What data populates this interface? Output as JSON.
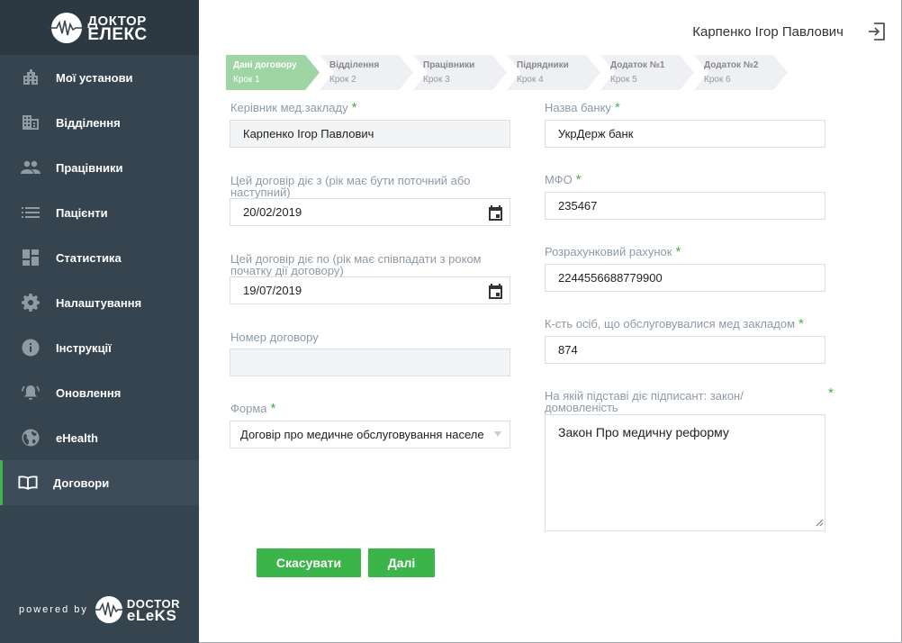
{
  "brand": {
    "logo_line1": "ДОКТОР",
    "logo_line2": "ЕЛЕКС",
    "powered_by": "powered by",
    "footer_line1": "DOCTOR",
    "footer_line2": "eLeKS"
  },
  "sidebar": {
    "items": [
      {
        "label": "Мої установи",
        "icon": "building-icon"
      },
      {
        "label": "Відділення",
        "icon": "office-icon"
      },
      {
        "label": "Працівники",
        "icon": "people-icon"
      },
      {
        "label": "Пацієнти",
        "icon": "list-icon"
      },
      {
        "label": "Статистика",
        "icon": "dashboard-icon"
      },
      {
        "label": "Налаштування",
        "icon": "gear-icon"
      },
      {
        "label": "Інструкції",
        "icon": "info-icon"
      },
      {
        "label": "Оновлення",
        "icon": "bell-icon"
      },
      {
        "label": "eHealth",
        "icon": "globe-icon"
      },
      {
        "label": "Договори",
        "icon": "book-icon",
        "active": true
      }
    ]
  },
  "header": {
    "user_name": "Карпенко Ігор Павлович"
  },
  "steps": [
    {
      "title": "Дані договору",
      "sub": "Крок 1",
      "active": true
    },
    {
      "title": "Відділення",
      "sub": "Крок 2"
    },
    {
      "title": "Працівники",
      "sub": "Крок 3"
    },
    {
      "title": "Підрядники",
      "sub": "Крок 4"
    },
    {
      "title": "Додаток №1",
      "sub": "Крок 5"
    },
    {
      "title": "Додаток №2",
      "sub": "Крок 6"
    }
  ],
  "form": {
    "head_label": "Керівник мед.закладу",
    "head_value": "Карпенко Ігор Павлович",
    "from_label": "Цей договір діє з (рік має бути поточний або наступний)",
    "from_value": "20/02/2019",
    "to_label": "Цей договір діє по (рік має співпадати з роком початку дії договору)",
    "to_value": "19/07/2019",
    "number_label": "Номер договору",
    "number_value": "",
    "form_label": "Форма",
    "form_value": "Договір про медичне обслуговування населе",
    "bank_label": "Назва банку",
    "bank_value": "УкрДерж банк",
    "mfo_label": "МФО",
    "mfo_value": "235467",
    "account_label": "Розрахунковий рахунок",
    "account_value": "2244556688779900",
    "persons_label": "К-сть осіб, що обслуговувалися мед закладом",
    "persons_value": "874",
    "basis_label": "На якій підставі діє підписант: закон/домовленість",
    "basis_value": "Закон Про медичну реформу",
    "required_mark": "*"
  },
  "buttons": {
    "cancel": "Скасувати",
    "next": "Далі"
  },
  "colors": {
    "sidebar_bg": "#36444f",
    "accent_green": "#3bb54a",
    "step_active": "#9fd5a5",
    "step_inactive": "#eef0f3"
  }
}
